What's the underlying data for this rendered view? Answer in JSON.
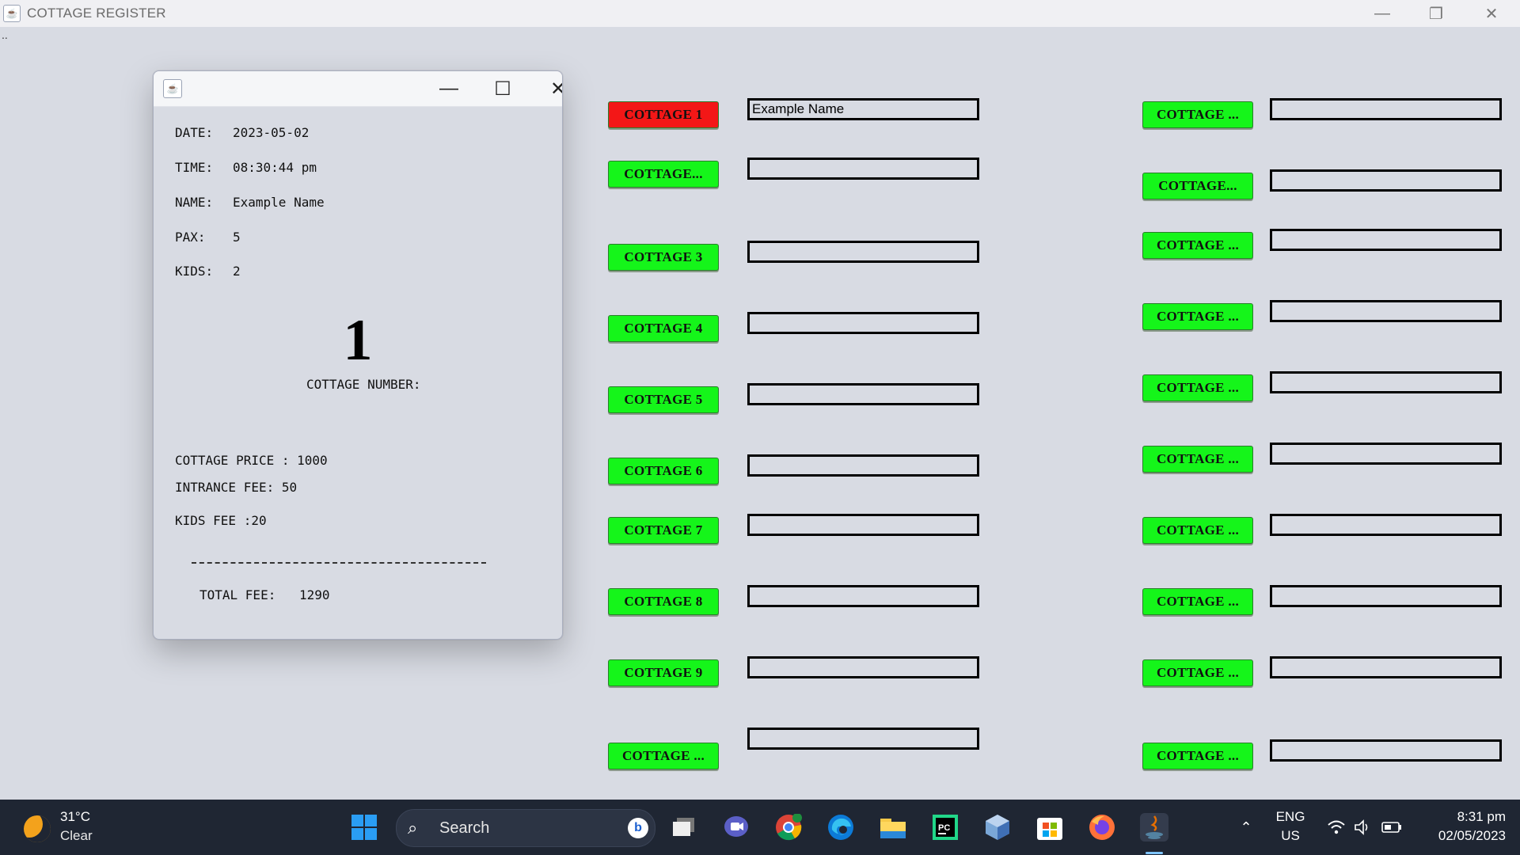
{
  "window": {
    "title": "COTTAGE REGISTER",
    "menu_dots": ".."
  },
  "dialog": {
    "date_label": "DATE:",
    "date_value": "2023-05-02",
    "time_label": "TIME:",
    "time_value": "08:30:44 pm",
    "name_label": "NAME:",
    "name_value": "Example Name",
    "pax_label": "PAX:",
    "pax_value": "5",
    "kids_label": "KIDS:",
    "kids_value": "2",
    "cottage_number": "1",
    "cottage_number_label": "COTTAGE NUMBER:",
    "cottage_price": "COTTAGE PRICE : 1000",
    "entrance_fee": "INTRANCE FEE: 50",
    "kids_fee": "KIDS FEE :20",
    "total_label": "TOTAL FEE:",
    "total_value": "1290"
  },
  "left_cottages": [
    {
      "label": "COTTAGE 1",
      "name": "Example Name",
      "status": "occupied"
    },
    {
      "label": "COTTAGE...",
      "name": ""
    },
    {
      "label": "COTTAGE 3",
      "name": ""
    },
    {
      "label": "COTTAGE 4",
      "name": ""
    },
    {
      "label": "COTTAGE 5",
      "name": ""
    },
    {
      "label": "COTTAGE 6",
      "name": ""
    },
    {
      "label": "COTTAGE 7",
      "name": ""
    },
    {
      "label": "COTTAGE 8",
      "name": ""
    },
    {
      "label": "COTTAGE 9",
      "name": ""
    },
    {
      "label": "COTTAGE ...",
      "name": ""
    }
  ],
  "right_cottages": [
    {
      "label": "COTTAGE ...",
      "name": ""
    },
    {
      "label": "COTTAGE...",
      "name": ""
    },
    {
      "label": "COTTAGE ...",
      "name": ""
    },
    {
      "label": "COTTAGE ...",
      "name": ""
    },
    {
      "label": "COTTAGE ...",
      "name": ""
    },
    {
      "label": "COTTAGE ...",
      "name": ""
    },
    {
      "label": "COTTAGE ...",
      "name": ""
    },
    {
      "label": "COTTAGE ...",
      "name": ""
    },
    {
      "label": "COTTAGE ...",
      "name": ""
    },
    {
      "label": "COTTAGE ...",
      "name": ""
    }
  ],
  "colors": {
    "available": "#15f51a",
    "occupied": "#f31717",
    "background": "#d8dbe3",
    "taskbar": "#1f2633"
  },
  "taskbar": {
    "weather_temp": "31°C",
    "weather_desc": "Clear",
    "search_placeholder": "Search",
    "apps": [
      "start-icon",
      "task-view-icon",
      "chat-icon",
      "chrome-icon",
      "edge-icon",
      "file-explorer-icon",
      "pycharm-icon",
      "virtualbox-icon",
      "store-icon",
      "firefox-icon",
      "java-icon"
    ],
    "language": "ENG",
    "region": "US",
    "time": "8:31 pm",
    "date": "02/05/2023"
  }
}
